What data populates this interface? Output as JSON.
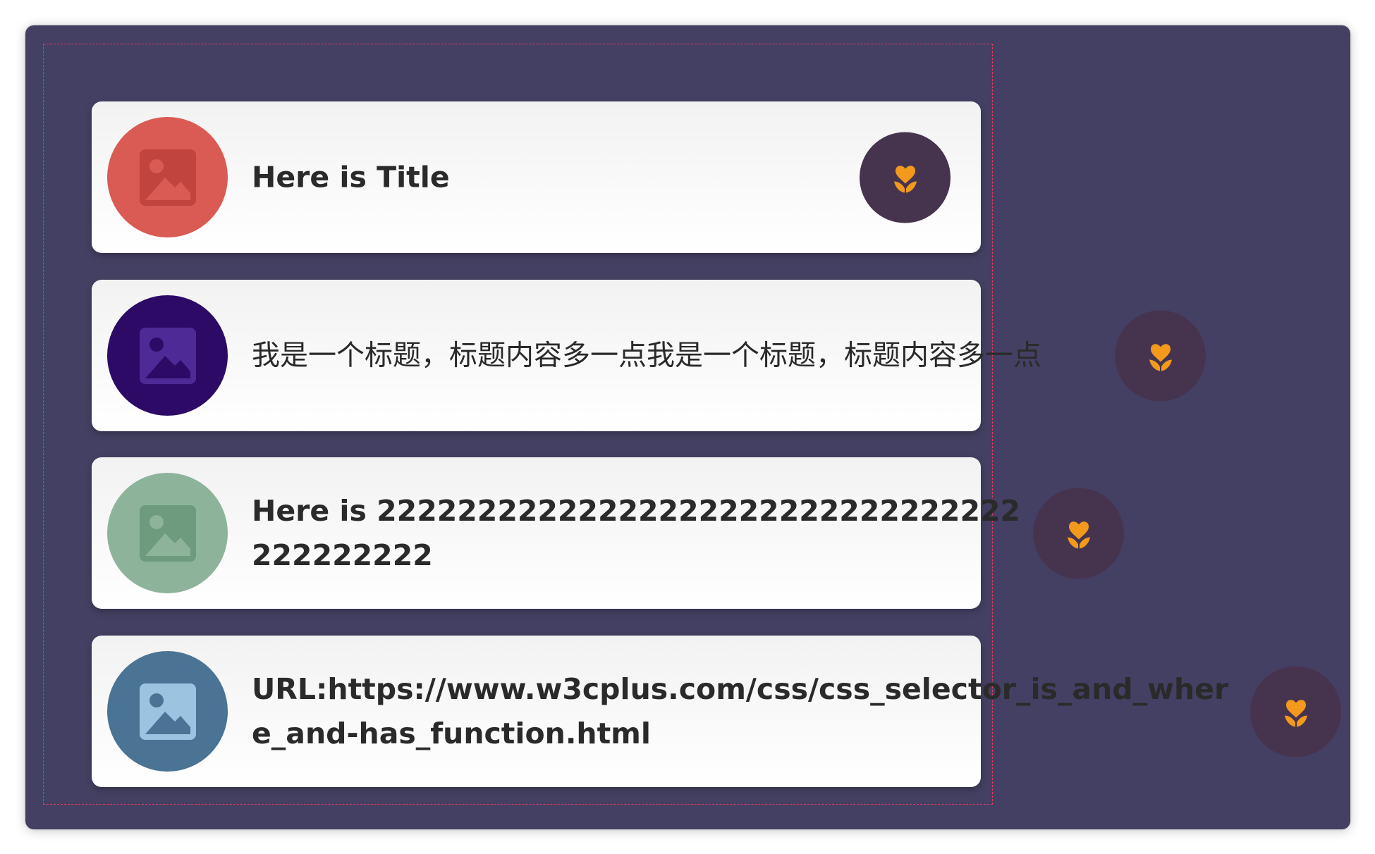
{
  "colors": {
    "stage_bg": "#444063",
    "container_border": "#e23b5f",
    "card_bg": "#ffffff",
    "title_text": "#2a2a2a",
    "action_bg": "#46344f",
    "action_icon": "#f39a1d"
  },
  "items": [
    {
      "title": "Here is Title",
      "avatar_color": "#d95b53",
      "avatar_icon_fill": "#c2443f",
      "icon": "image-icon",
      "action_icon": "flower-icon"
    },
    {
      "title": "我是一个标题，标题内容多一点我是一个标题，标题内容多一点",
      "avatar_color": "#2c0a66",
      "avatar_icon_fill": "#4e2a97",
      "icon": "image-icon",
      "action_icon": "flower-icon"
    },
    {
      "title": "Here is 22222222222222222222222222222222222222222",
      "avatar_color": "#8db49a",
      "avatar_icon_fill": "#6e9a7e",
      "icon": "image-icon",
      "action_icon": "flower-icon"
    },
    {
      "title": "URL:https://www.w3cplus.com/css/css_selector_is_and_where_and-has_function.html",
      "avatar_color": "#4a7394",
      "avatar_icon_fill": "#9cc3df",
      "icon": "image-icon",
      "action_icon": "flower-icon"
    }
  ]
}
